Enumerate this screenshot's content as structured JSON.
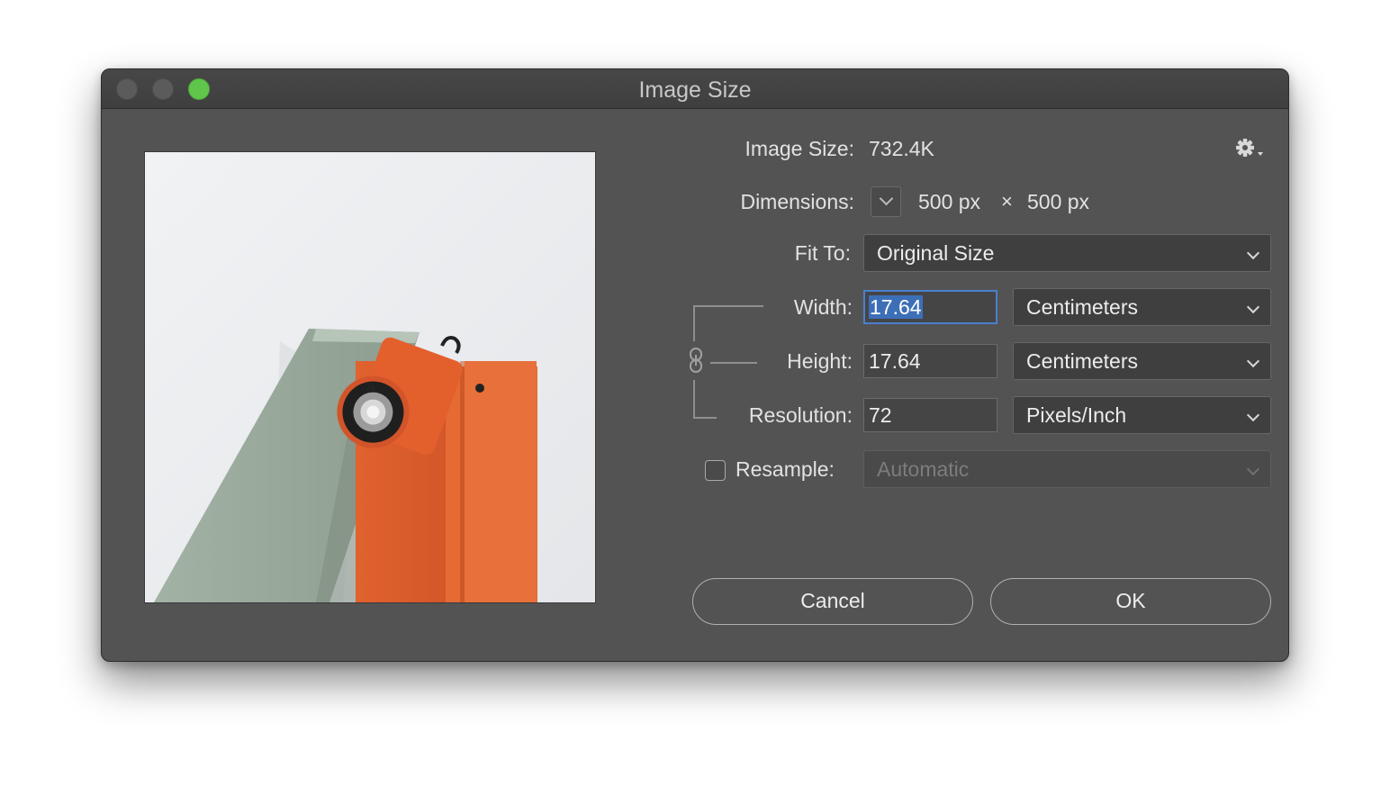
{
  "window": {
    "title": "Image Size",
    "traffic_lights": [
      "close",
      "minimize",
      "zoom"
    ],
    "zoom_color": "#5fc54b"
  },
  "preview": {
    "description_icon": "image-preview",
    "colors": {
      "background": "#eef0f2",
      "shelf": "#9aab9d",
      "lamp": "#e2642f"
    }
  },
  "image_size": {
    "label": "Image Size:",
    "value": "732.4K"
  },
  "dimensions": {
    "label": "Dimensions:",
    "width": "500 px",
    "separator": "×",
    "height": "500 px"
  },
  "fit_to": {
    "label": "Fit To:",
    "value": "Original Size"
  },
  "width": {
    "label": "Width:",
    "value": "17.64",
    "unit": "Centimeters"
  },
  "height": {
    "label": "Height:",
    "value": "17.64",
    "unit": "Centimeters"
  },
  "resolution": {
    "label": "Resolution:",
    "value": "72",
    "unit": "Pixels/Inch"
  },
  "resample": {
    "label": "Resample:",
    "checked": false,
    "value": "Automatic"
  },
  "buttons": {
    "cancel": "Cancel",
    "ok": "OK"
  },
  "colors": {
    "window_bg": "#535353",
    "focus_ring": "#4a7fd0",
    "selection": "#3d6fb8"
  }
}
